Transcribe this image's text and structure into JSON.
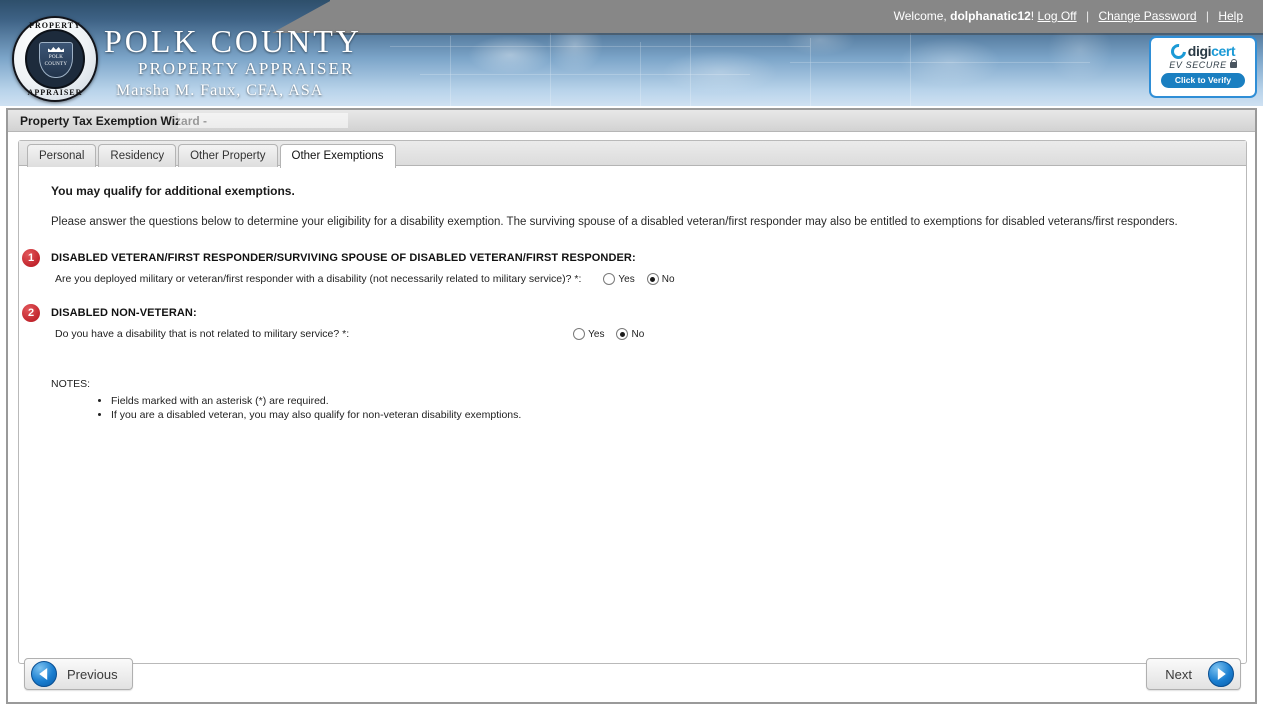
{
  "header": {
    "welcome_prefix": "Welcome, ",
    "username": "dolphanatic12",
    "welcome_suffix": "!",
    "log_off": "Log Off",
    "change_password": "Change Password",
    "help": "Help",
    "separator": "|",
    "agency_line1": "POLK COUNTY",
    "agency_line2": "PROPERTY APPRAISER",
    "agency_line3": "Marsha M. Faux, CFA, ASA",
    "seal_arc_top": "PROPERTY",
    "seal_arc_bottom": "APPRAISER",
    "seal_shield_line1": "POLK",
    "seal_shield_line2": "COUNTY",
    "digicert": {
      "brand_part1": "digi",
      "brand_part2": "cert",
      "tagline": "EV SECURE",
      "verify_label": "Click to Verify"
    },
    "colors": {
      "gray_band": "#878787",
      "blue_dark": "#2e4f6b",
      "blue_light": "#cfe1f2",
      "digicert_blue": "#1b9ad6"
    }
  },
  "wizard": {
    "title": "Property Tax Exemption Wizard -",
    "tabs": [
      {
        "label": "Personal",
        "active": false
      },
      {
        "label": "Residency",
        "active": false
      },
      {
        "label": "Other Property",
        "active": false
      },
      {
        "label": "Other Exemptions",
        "active": true
      }
    ]
  },
  "content": {
    "lead": "You may qualify for additional exemptions.",
    "intro": "Please answer the questions below to determine your eligibility for a disability exemption. The surviving spouse of a disabled veteran/first responder may also be entitled to exemptions for disabled veterans/first responders.",
    "questions": [
      {
        "number": "1",
        "heading": "DISABLED VETERAN/FIRST RESPONDER/SURVIVING SPOUSE OF DISABLED VETERAN/FIRST RESPONDER:",
        "label": "Are you deployed military or veteran/first responder with a disability (not necessarily related to military service)? *:",
        "options": [
          {
            "label": "Yes",
            "selected": false
          },
          {
            "label": "No",
            "selected": true
          }
        ]
      },
      {
        "number": "2",
        "heading": "DISABLED NON-VETERAN:",
        "label": "Do you have a disability that is not related to military service? *:",
        "options": [
          {
            "label": "Yes",
            "selected": false
          },
          {
            "label": "No",
            "selected": true
          }
        ]
      }
    ],
    "notes_title": "NOTES:",
    "notes": [
      "Fields marked with an asterisk (*) are required.",
      "If you are a disabled veteran, you may also qualify for non-veteran disability exemptions."
    ],
    "badge_color": "#c0232b"
  },
  "nav": {
    "previous": "Previous",
    "next": "Next"
  }
}
